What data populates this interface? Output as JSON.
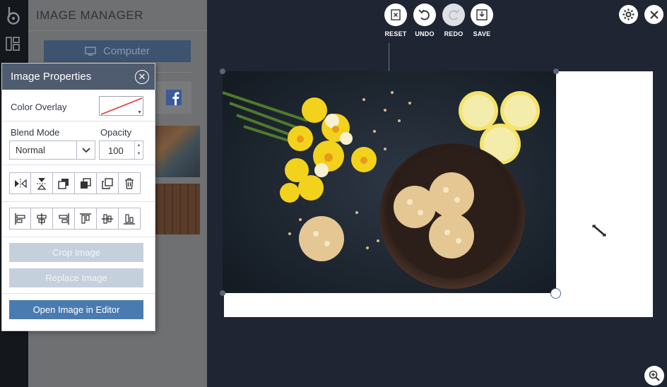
{
  "manager": {
    "title": "IMAGE MANAGER",
    "computer_label": "Computer"
  },
  "properties": {
    "title": "Image Properties",
    "color_overlay_label": "Color Overlay",
    "blend_mode_label": "Blend Mode",
    "blend_mode_value": "Normal",
    "opacity_label": "Opacity",
    "opacity_value": "100",
    "crop_label": "Crop Image",
    "replace_label": "Replace Image",
    "editor_label": "Open Image in Editor"
  },
  "toolbar": {
    "reset": "RESET",
    "undo": "UNDO",
    "redo": "REDO",
    "save": "SAVE"
  },
  "colors": {
    "panel_header": "#4f5b6e",
    "primary_button": "#4a7bb0",
    "disabled_button": "#c5d0dd",
    "workspace": "#1f2533"
  }
}
